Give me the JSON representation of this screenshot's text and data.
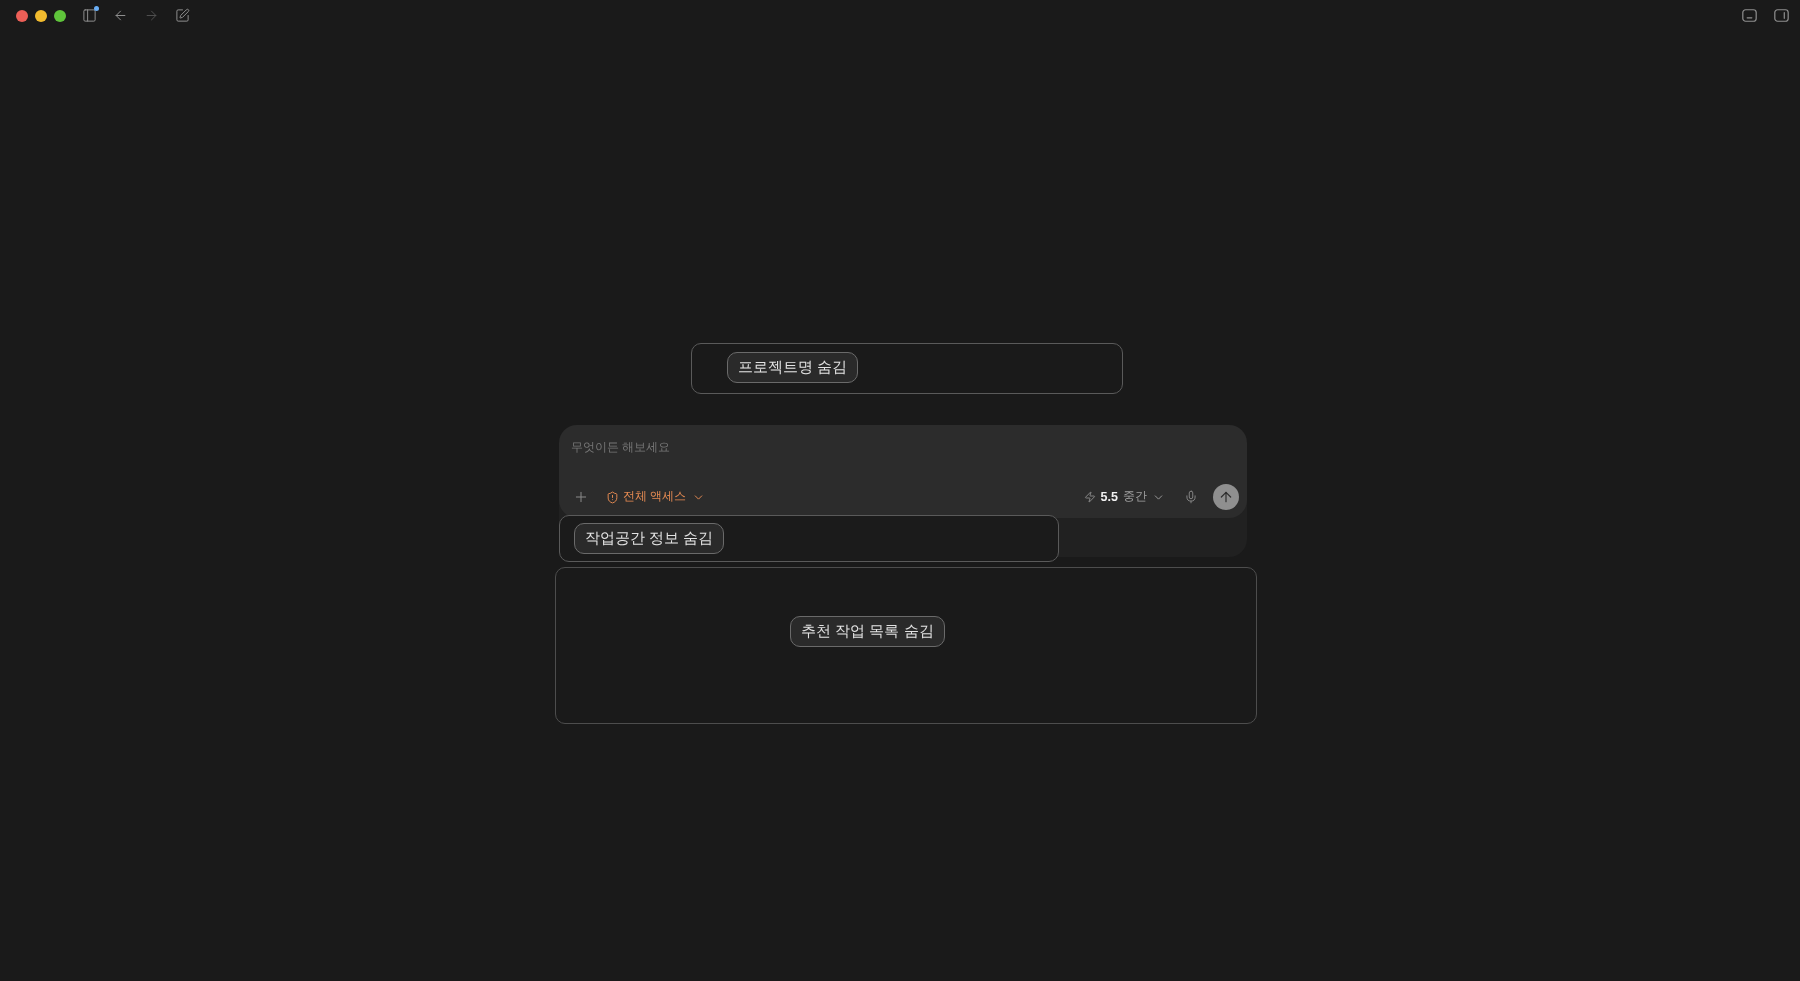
{
  "toolbar": {
    "left": [
      {
        "kind": "sidebar",
        "disabled": false,
        "badge": true
      },
      {
        "kind": "back",
        "disabled": false,
        "badge": false
      },
      {
        "kind": "forward",
        "disabled": true,
        "badge": false
      },
      {
        "kind": "compose",
        "disabled": false,
        "badge": false
      }
    ],
    "right": [
      {
        "kind": "bottom-panel"
      },
      {
        "kind": "side-panel"
      }
    ]
  },
  "project_box": {
    "label": "프로젝트명 숨김"
  },
  "composer": {
    "placeholder": "무엇이든 해보세요",
    "access": {
      "label": "전체 액세스"
    },
    "model": {
      "version": "5.5",
      "effort": "중간"
    },
    "send_button": {
      "disabled": true
    }
  },
  "workspace_box": {
    "label": "작업공간 정보 숨김"
  },
  "suggestions_box": {
    "label": "추천 작업 목록 숨김"
  }
}
